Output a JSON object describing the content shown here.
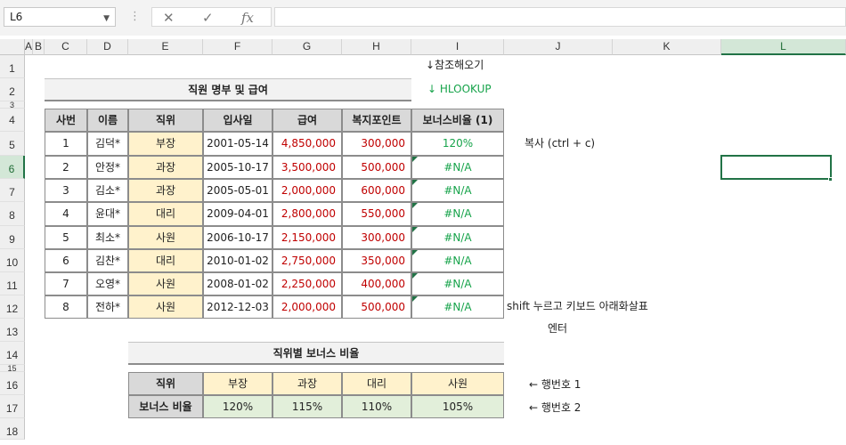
{
  "formula_bar": {
    "name_box": "L6",
    "cancel_icon": "✕",
    "enter_icon": "✓",
    "fx_icon": "fx",
    "formula": ""
  },
  "columns": [
    "A",
    "B",
    "C",
    "D",
    "E",
    "F",
    "G",
    "H",
    "I",
    "J",
    "K",
    "L"
  ],
  "rows": [
    "1",
    "2",
    "3",
    "4",
    "5",
    "6",
    "7",
    "8",
    "9",
    "10",
    "11",
    "12",
    "13",
    "14",
    "15",
    "16",
    "17",
    "18"
  ],
  "notes": {
    "ref": "↓참조해오기",
    "hlookup": "↓ HLOOKUP",
    "copy": "복사 (ctrl + c)",
    "shift": "shift 누르고 키보드 아래화살표",
    "enter": "엔터",
    "row1": "← 행번호 1",
    "row2": "← 행번호 2"
  },
  "title_main": "직원 명부 및 급여",
  "table_headers": [
    "사번",
    "이름",
    "직위",
    "입사일",
    "급여",
    "복지포인트",
    "보너스비율 (1)"
  ],
  "employees": [
    [
      "1",
      "김덕*",
      "부장",
      "2001-05-14",
      "4,850,000",
      "300,000",
      "120%"
    ],
    [
      "2",
      "안정*",
      "과장",
      "2005-10-17",
      "3,500,000",
      "500,000",
      "#N/A"
    ],
    [
      "3",
      "김소*",
      "과장",
      "2005-05-01",
      "2,000,000",
      "600,000",
      "#N/A"
    ],
    [
      "4",
      "윤대*",
      "대리",
      "2009-04-01",
      "2,800,000",
      "550,000",
      "#N/A"
    ],
    [
      "5",
      "최소*",
      "사원",
      "2006-10-17",
      "2,150,000",
      "300,000",
      "#N/A"
    ],
    [
      "6",
      "김찬*",
      "대리",
      "2010-01-02",
      "2,750,000",
      "350,000",
      "#N/A"
    ],
    [
      "7",
      "오영*",
      "사원",
      "2008-01-02",
      "2,250,000",
      "400,000",
      "#N/A"
    ],
    [
      "8",
      "전하*",
      "사원",
      "2012-12-03",
      "2,000,000",
      "500,000",
      "#N/A"
    ]
  ],
  "title_bonus": "직위별 보너스 비율",
  "bonus_table": {
    "row1_label": "직위",
    "positions": [
      "부장",
      "과장",
      "대리",
      "사원"
    ],
    "row2_label": "보너스 비율",
    "rates": [
      "120%",
      "115%",
      "110%",
      "105%"
    ]
  },
  "colors": {
    "accent": "#217346",
    "value_red": "#c00000",
    "formula_green": "#16a34a",
    "yellow": "#fff2cc",
    "light_green": "#e2efda"
  }
}
